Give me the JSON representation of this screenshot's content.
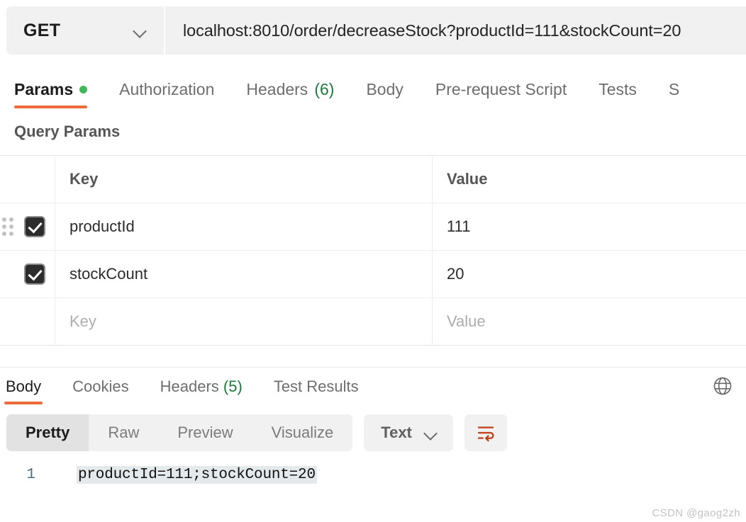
{
  "request": {
    "method": "GET",
    "method_icon": "chevron-down-icon",
    "url": "localhost:8010/order/decreaseStock?productId=111&stockCount=20",
    "tabs": [
      {
        "label": "Params",
        "badge": "",
        "dot": true,
        "active": true
      },
      {
        "label": "Authorization",
        "badge": "",
        "dot": false,
        "active": false
      },
      {
        "label": "Headers",
        "badge": "(6)",
        "dot": false,
        "active": false
      },
      {
        "label": "Body",
        "badge": "",
        "dot": false,
        "active": false
      },
      {
        "label": "Pre-request Script",
        "badge": "",
        "dot": false,
        "active": false
      },
      {
        "label": "Tests",
        "badge": "",
        "dot": false,
        "active": false
      },
      {
        "label": "S",
        "badge": "",
        "dot": false,
        "active": false
      }
    ],
    "section_title": "Query Params",
    "table": {
      "headers": {
        "key": "Key",
        "value": "Value"
      },
      "rows": [
        {
          "checked": true,
          "key": "productId",
          "value": "111",
          "drag": true,
          "placeholder": false
        },
        {
          "checked": true,
          "key": "stockCount",
          "value": "20",
          "drag": false,
          "placeholder": false
        },
        {
          "checked": false,
          "key": "Key",
          "value": "Value",
          "drag": false,
          "placeholder": true
        }
      ]
    }
  },
  "response": {
    "tabs": [
      {
        "label": "Body",
        "badge": "",
        "active": true
      },
      {
        "label": "Cookies",
        "badge": "",
        "active": false
      },
      {
        "label": "Headers",
        "badge": "(5)",
        "active": false
      },
      {
        "label": "Test Results",
        "badge": "",
        "active": false
      }
    ],
    "globe_icon": "globe-icon",
    "view_modes": [
      {
        "label": "Pretty",
        "active": true
      },
      {
        "label": "Raw",
        "active": false
      },
      {
        "label": "Preview",
        "active": false
      },
      {
        "label": "Visualize",
        "active": false
      }
    ],
    "format": "Text",
    "format_icon": "chevron-down-icon",
    "wrap_icon": "word-wrap-icon",
    "body": {
      "line_number": "1",
      "content": "productId=111;stockCount=20"
    }
  },
  "colors": {
    "accent_orange": "#ef6a39",
    "status_green": "#44b858",
    "count_green": "#1d7a3e",
    "wrap_icon": "#c0441e",
    "panel_gray": "#f1f1f1",
    "selection": "#e4eaec"
  },
  "watermark": "CSDN @gaog2zh"
}
